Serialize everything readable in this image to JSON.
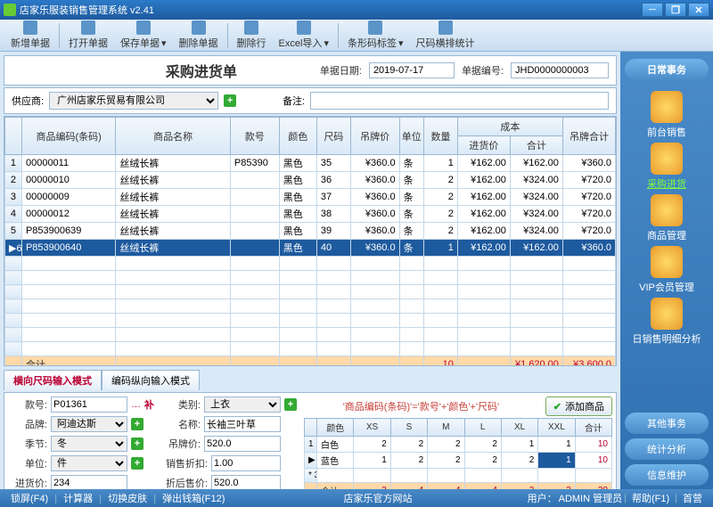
{
  "window": {
    "title": "店家乐服装销售管理系统 v2.41"
  },
  "toolbar": {
    "items": [
      {
        "label": "新增单据",
        "name": "new-doc"
      },
      {
        "label": "打开单据",
        "name": "open-doc"
      },
      {
        "label": "保存单据",
        "name": "save-doc",
        "dd": true
      },
      {
        "label": "删除单据",
        "name": "del-doc"
      },
      {
        "label": "删除行",
        "name": "del-row"
      },
      {
        "label": "Excel导入",
        "name": "excel-import",
        "dd": true
      },
      {
        "label": "条形码标签",
        "name": "barcode",
        "dd": true
      },
      {
        "label": "尺码横排统计",
        "name": "size-stats"
      }
    ]
  },
  "doc": {
    "title": "采购进货单",
    "date_label": "单据日期:",
    "date": "2019-07-17",
    "no_label": "单据编号:",
    "no": "JHD0000000003",
    "supplier_label": "供应商:",
    "supplier": "广州店家乐贸易有限公司",
    "remark_label": "备注:",
    "remark": ""
  },
  "grid": {
    "headers": [
      "商品编码(条码)",
      "商品名称",
      "款号",
      "颜色",
      "尺码",
      "吊牌价",
      "单位",
      "数量",
      "进货价",
      "合计",
      "吊牌合计"
    ],
    "cost_group": "成本",
    "rows": [
      {
        "code": "00000011",
        "name": "丝绒长裤",
        "style": "P85390",
        "color": "黑色",
        "size": "35",
        "tag": "¥360.0",
        "unit": "条",
        "qty": "1",
        "price": "¥162.00",
        "amt": "¥162.00",
        "tagamt": "¥360.0"
      },
      {
        "code": "00000010",
        "name": "丝绒长裤",
        "style": "",
        "color": "黑色",
        "size": "36",
        "tag": "¥360.0",
        "unit": "条",
        "qty": "2",
        "price": "¥162.00",
        "amt": "¥324.00",
        "tagamt": "¥720.0"
      },
      {
        "code": "00000009",
        "name": "丝绒长裤",
        "style": "",
        "color": "黑色",
        "size": "37",
        "tag": "¥360.0",
        "unit": "条",
        "qty": "2",
        "price": "¥162.00",
        "amt": "¥324.00",
        "tagamt": "¥720.0"
      },
      {
        "code": "00000012",
        "name": "丝绒长裤",
        "style": "",
        "color": "黑色",
        "size": "38",
        "tag": "¥360.0",
        "unit": "条",
        "qty": "2",
        "price": "¥162.00",
        "amt": "¥324.00",
        "tagamt": "¥720.0"
      },
      {
        "code": "P853900639",
        "name": "丝绒长裤",
        "style": "",
        "color": "黑色",
        "size": "39",
        "tag": "¥360.0",
        "unit": "条",
        "qty": "2",
        "price": "¥162.00",
        "amt": "¥324.00",
        "tagamt": "¥720.0"
      },
      {
        "code": "P853900640",
        "name": "丝绒长裤",
        "style": "",
        "color": "黑色",
        "size": "40",
        "tag": "¥360.0",
        "unit": "条",
        "qty": "1",
        "price": "¥162.00",
        "amt": "¥162.00",
        "tagamt": "¥360.0"
      }
    ],
    "sum_label": "合计",
    "sum_qty": "10",
    "sum_amt": "¥1,620.00",
    "sum_tag": "¥3,600.0"
  },
  "tabs": {
    "active": "横向尺码输入模式",
    "other": "编码纵向输入模式"
  },
  "entry": {
    "style_label": "款号:",
    "style": "P01361",
    "supp": "补",
    "cat_label": "类别:",
    "cat": "上衣",
    "brand_label": "品牌:",
    "brand": "阿迪达斯",
    "name_label": "名称:",
    "name": "长袖三叶草",
    "season_label": "季节:",
    "season": "冬",
    "tag_label": "吊牌价:",
    "tag": "520.0",
    "unit_label": "单位:",
    "unit": "件",
    "disc_label": "销售折扣:",
    "disc": "1.00",
    "cost_label": "进货价:",
    "cost": "234",
    "after_label": "折后售价:",
    "after": "520.0",
    "hint": "'商品编码(条码)'='款号'+'颜色'+'尺码'",
    "add_btn": "添加商品"
  },
  "size": {
    "headers": [
      "颜色",
      "XS",
      "S",
      "M",
      "L",
      "XL",
      "XXL",
      "合计"
    ],
    "rows": [
      {
        "n": "1",
        "color": "白色",
        "vals": [
          "2",
          "2",
          "2",
          "2",
          "1",
          "1"
        ],
        "sum": "10"
      },
      {
        "n": "2",
        "color": "蓝色",
        "vals": [
          "1",
          "2",
          "2",
          "2",
          "2",
          "1"
        ],
        "sum": "10"
      },
      {
        "n": "3",
        "color": "",
        "vals": [
          "",
          "",
          "",
          "",
          "",
          ""
        ],
        "sum": ""
      }
    ],
    "sum": {
      "label": "合计",
      "vals": [
        "3",
        "4",
        "4",
        "4",
        "3",
        "2"
      ],
      "total": "20"
    }
  },
  "sidebar": {
    "header": "日常事务",
    "items": [
      {
        "label": "前台销售",
        "name": "pos"
      },
      {
        "label": "采购进货",
        "name": "purchase",
        "active": true
      },
      {
        "label": "商品管理",
        "name": "product"
      },
      {
        "label": "VIP会员管理",
        "name": "vip"
      },
      {
        "label": "日销售明细分析",
        "name": "daily-analysis"
      }
    ],
    "buttons": [
      {
        "label": "其他事务",
        "name": "other-tasks"
      },
      {
        "label": "统计分析",
        "name": "stats"
      },
      {
        "label": "信息维护",
        "name": "info-maint"
      }
    ]
  },
  "statusbar": {
    "items": [
      "锁屏(F4)",
      "计算器",
      "切换皮肤",
      "弹出钱箱(F12)"
    ],
    "center": "店家乐官方网站",
    "user_label": "用户：",
    "user": "ADMIN 管理员",
    "help": "帮助(F1)",
    "casher": "首营"
  }
}
